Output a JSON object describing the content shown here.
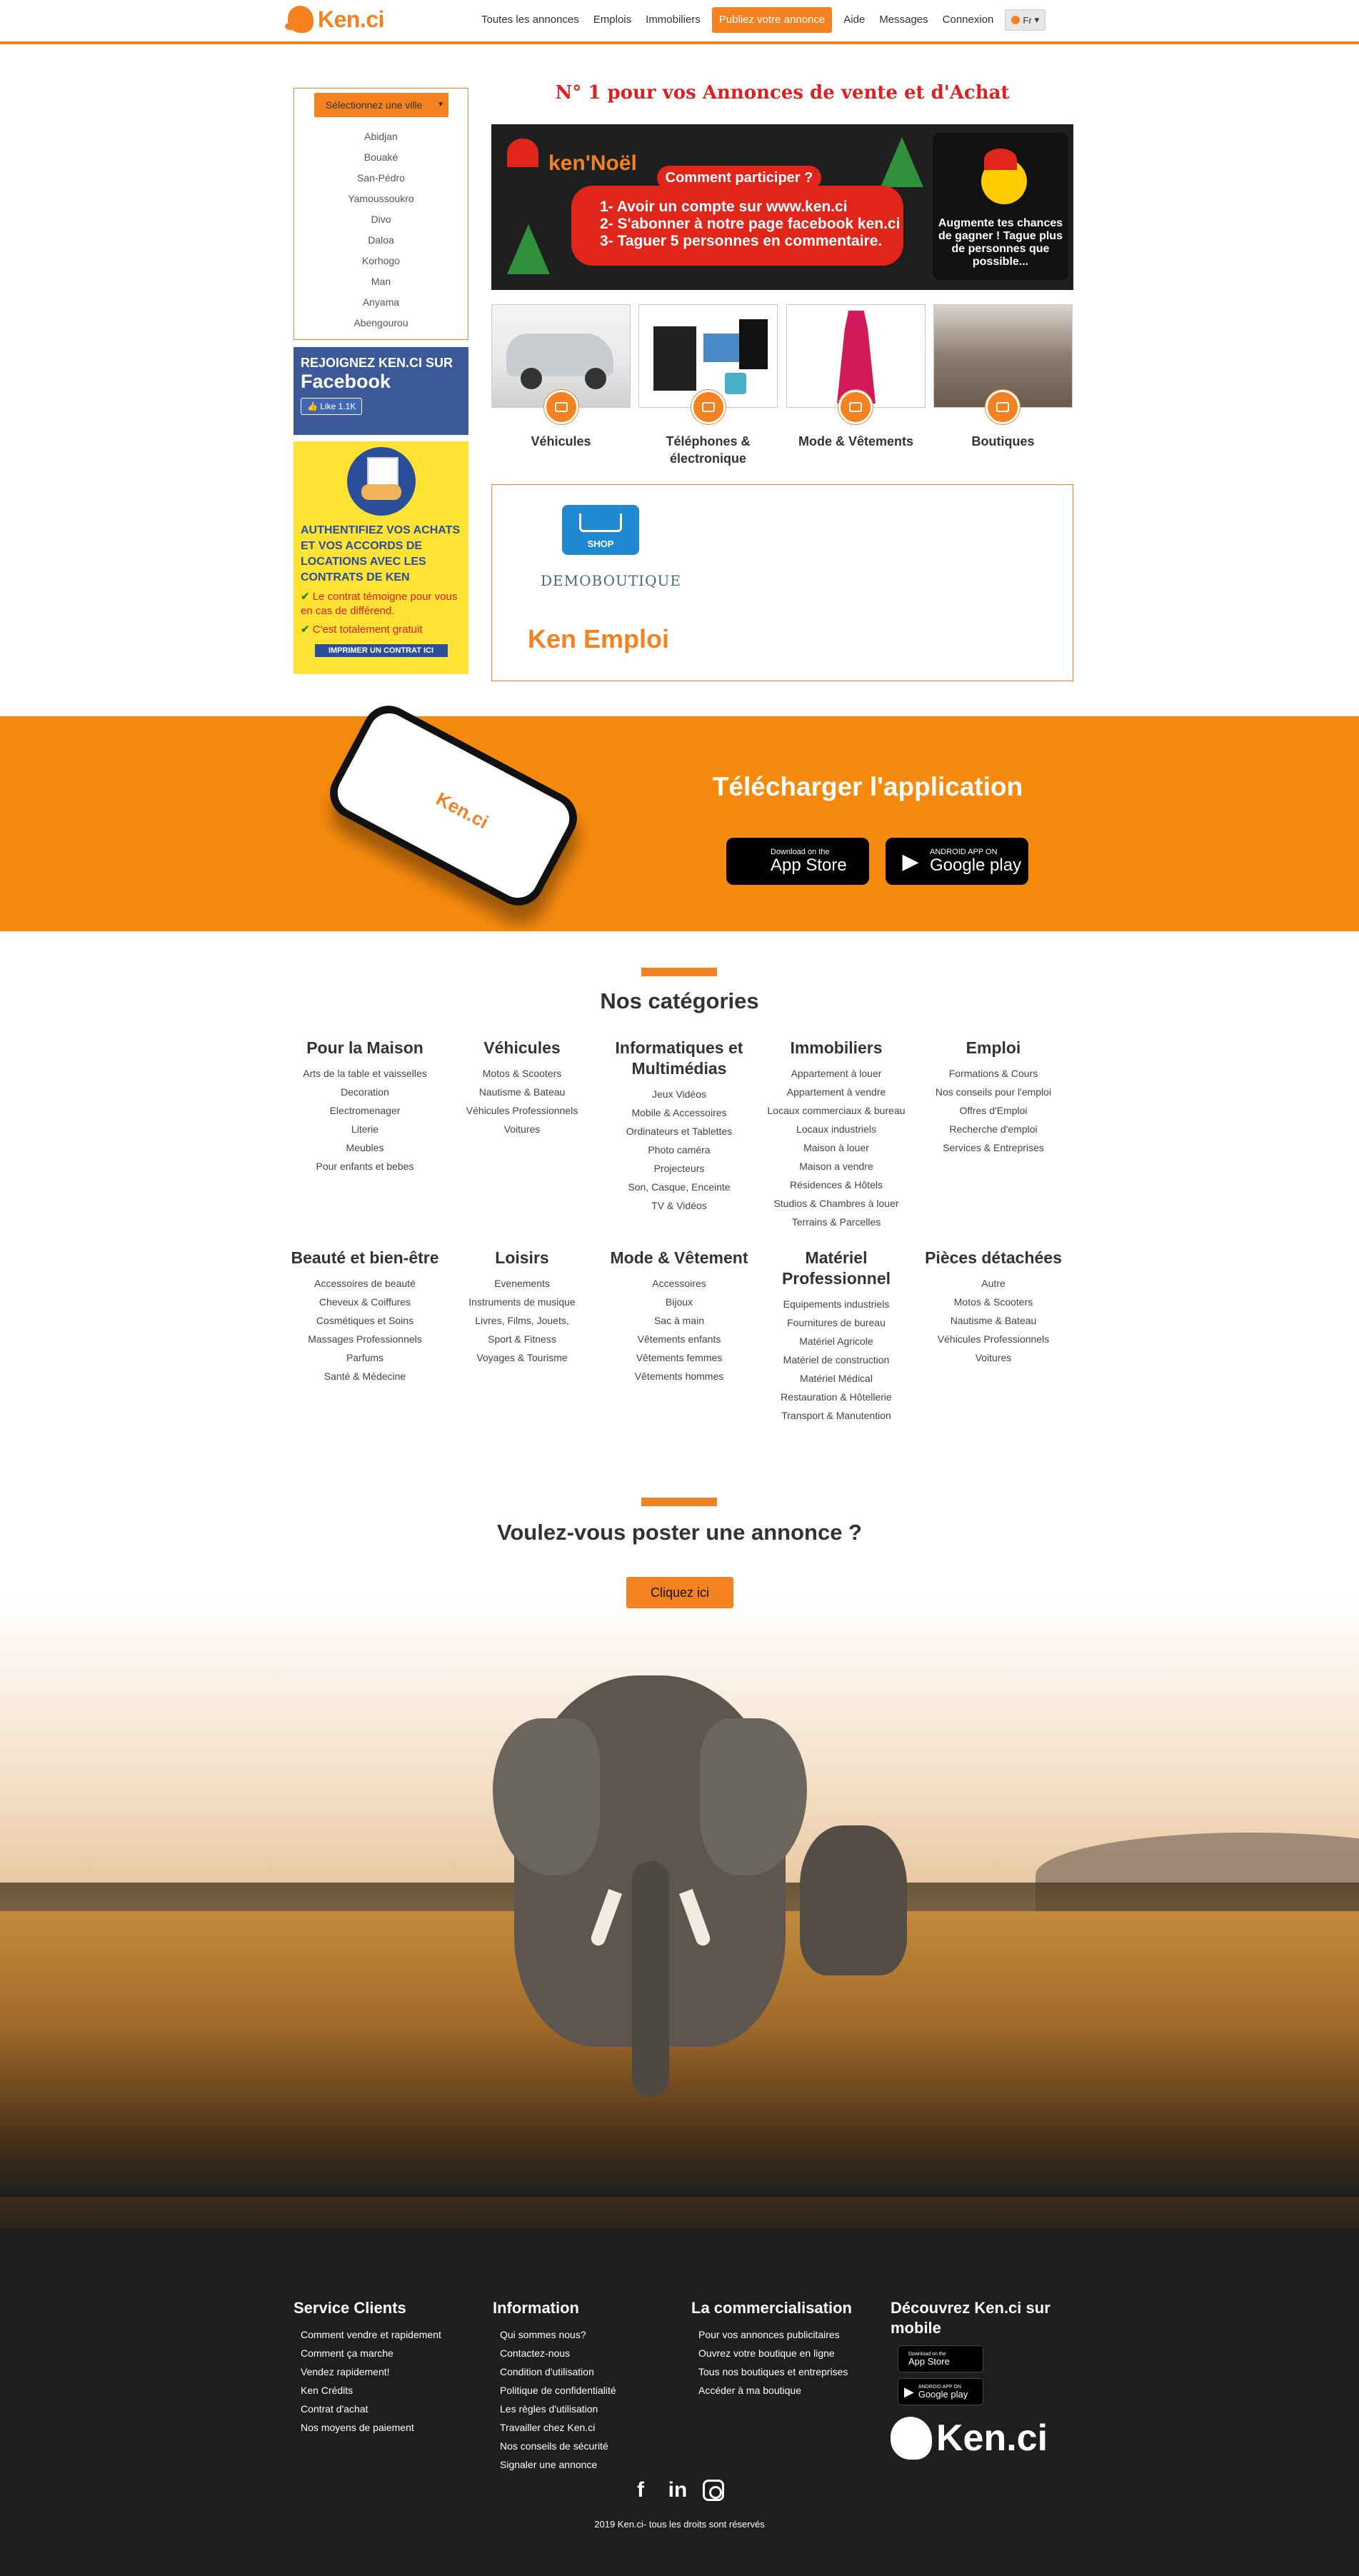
{
  "brand": {
    "name": "Ken.ci",
    "accent": "#f58220"
  },
  "nav": {
    "links": [
      "Toutes les annonces",
      "Emplois",
      "Immobiliers",
      "Publiez votre annonce",
      "Aide",
      "Messages",
      "Connexion"
    ],
    "lang": "Fr"
  },
  "sidebar": {
    "city_select": "Sélectionnez une ville",
    "cities": [
      "Abidjan",
      "Bouaké",
      "San-Pédro",
      "Yamoussoukro",
      "Divo",
      "Daloa",
      "Korhogo",
      "Man",
      "Anyama",
      "Abengourou"
    ],
    "facebook": {
      "line1": "REJOIGNEZ KEN.CI SUR",
      "line2": "Facebook",
      "like": "Like 1.1K"
    },
    "contract": {
      "title": "AUTHENTIFIEZ VOS ACHATS ET VOS ACCORDS DE LOCATIONS AVEC LES CONTRATS DE KEN",
      "check1": "Le contrat témoigne pour vous en cas de différend.",
      "check2": "C'est totalement gratuit",
      "button": "IMPRIMER UN CONTRAT ICI"
    }
  },
  "main": {
    "headline": "N° 1 pour vos Annonces de vente et d'Achat",
    "banner": {
      "brand": "ken'Noël",
      "pill": "Comment participer ?",
      "step1": "1- Avoir un compte sur www.ken.ci",
      "step2": "2- S'abonner à notre page facebook ken.ci",
      "step3": "3- Taguer 5 personnes en commentaire.",
      "right": "Augmente tes chances de gagner ! Tague plus de personnes que possible..."
    },
    "tiles": [
      "Véhicules",
      "Téléphones & électronique",
      "Mode & Vêtements",
      "Boutiques"
    ],
    "shop": {
      "cart_label": "SHOP",
      "demo": "DEMOBOUTIQUE",
      "emploi": "Ken Emploi"
    }
  },
  "app": {
    "phone_logo": "Ken.ci",
    "title": "Télécharger l'application",
    "appstore_small": "Download on the",
    "appstore_big": "App Store",
    "play_small": "ANDROID APP ON",
    "play_big": "Google play"
  },
  "categories": {
    "title": "Nos catégories",
    "groups": [
      {
        "title": "Pour la Maison",
        "items": [
          "Arts de la table et vaisselles",
          "Decoration",
          "Electromenager",
          "Literie",
          "Meubles",
          "Pour enfants et bebes"
        ]
      },
      {
        "title": "Véhicules",
        "items": [
          "Motos & Scooters",
          "Nautisme & Bateau",
          "Véhicules Professionnels",
          "Voitures"
        ]
      },
      {
        "title": "Informatiques et Multimédias",
        "items": [
          "Jeux Vidéos",
          "Mobile & Accessoires",
          "Ordinateurs et Tablettes",
          "Photo caméra",
          "Projecteurs",
          "Son, Casque, Enceinte",
          "TV & Vidéos"
        ]
      },
      {
        "title": "Immobiliers",
        "items": [
          "Appartement à louer",
          "Appartement à vendre",
          "Locaux commerciaux & bureau",
          "Locaux industriels",
          "Maison à louer",
          "Maison a vendre",
          "Résidences & Hôtels",
          "Studios & Chambres à louer",
          "Terrains & Parcelles"
        ]
      },
      {
        "title": "Emploi",
        "items": [
          "Formations & Cours",
          "Nos conseils pour l'emploi",
          "Offres d'Emploi",
          "Recherche d'emploi",
          "Services & Entreprises"
        ]
      },
      {
        "title": "Beauté et bien-être",
        "items": [
          "Accessoires de beauté",
          "Cheveux & Coiffures",
          "Cosmétiques et Soins",
          "Massages Professionnels",
          "Parfums",
          "Santé & Médecine"
        ]
      },
      {
        "title": "Loisirs",
        "items": [
          "Evenements",
          "Instruments de musique",
          "Livres, Films, Jouets,",
          "Sport & Fitness",
          "Voyages & Tourisme"
        ]
      },
      {
        "title": "Mode & Vêtement",
        "items": [
          "Accessoires",
          "Bijoux",
          "Sac à main",
          "Vêtements enfants",
          "Vêtements femmes",
          "Vêtements hommes"
        ]
      },
      {
        "title": "Matériel Professionnel",
        "items": [
          "Equipements industriels",
          "Fournitures de bureau",
          "Matériel Agricole",
          "Matériel de construction",
          "Matériel Médical",
          "Restauration & Hôtellerie",
          "Transport & Manutention"
        ]
      },
      {
        "title": "Pièces détachées",
        "items": [
          "Autre",
          "Motos & Scooters",
          "Nautisme & Bateau",
          "Véhicules Professionnels",
          "Voitures"
        ]
      }
    ]
  },
  "cta": {
    "title": "Voulez-vous poster une annonce ?",
    "button": "Cliquez ici"
  },
  "footer": {
    "service": {
      "title": "Service Clients",
      "items": [
        "Comment vendre et rapidement",
        "Comment ça marche",
        "Vendez rapidement!",
        "Ken Crédits",
        "Contrat d'achat",
        "Nos moyens de paiement"
      ]
    },
    "info": {
      "title": "Information",
      "items": [
        "Qui sommes nous?",
        "Contactez-nous",
        "Condition d'utilisation",
        "Politique de confidentialité",
        "Les règles d'utilisation",
        "Travailler chez Ken.ci",
        "Nos conseils de sécurité",
        "Signaler une annonce"
      ]
    },
    "commerce": {
      "title": "La commercialisation",
      "items": [
        "Pour vos annonces publicitaires",
        "Ouvrez votre boutique en ligne",
        "Tous nos boutiques et entreprises",
        "Accéder à ma boutique"
      ]
    },
    "mobile": {
      "title": "Découvrez Ken.ci sur mobile",
      "appstore_small": "Download on the",
      "appstore_big": "App Store",
      "play_small": "ANDROID APP ON",
      "play_big": "Google play",
      "logo": "Ken.ci"
    },
    "socials": [
      "f",
      "in"
    ],
    "copyright": "2019 Ken.ci- tous les droits sont réservés"
  }
}
